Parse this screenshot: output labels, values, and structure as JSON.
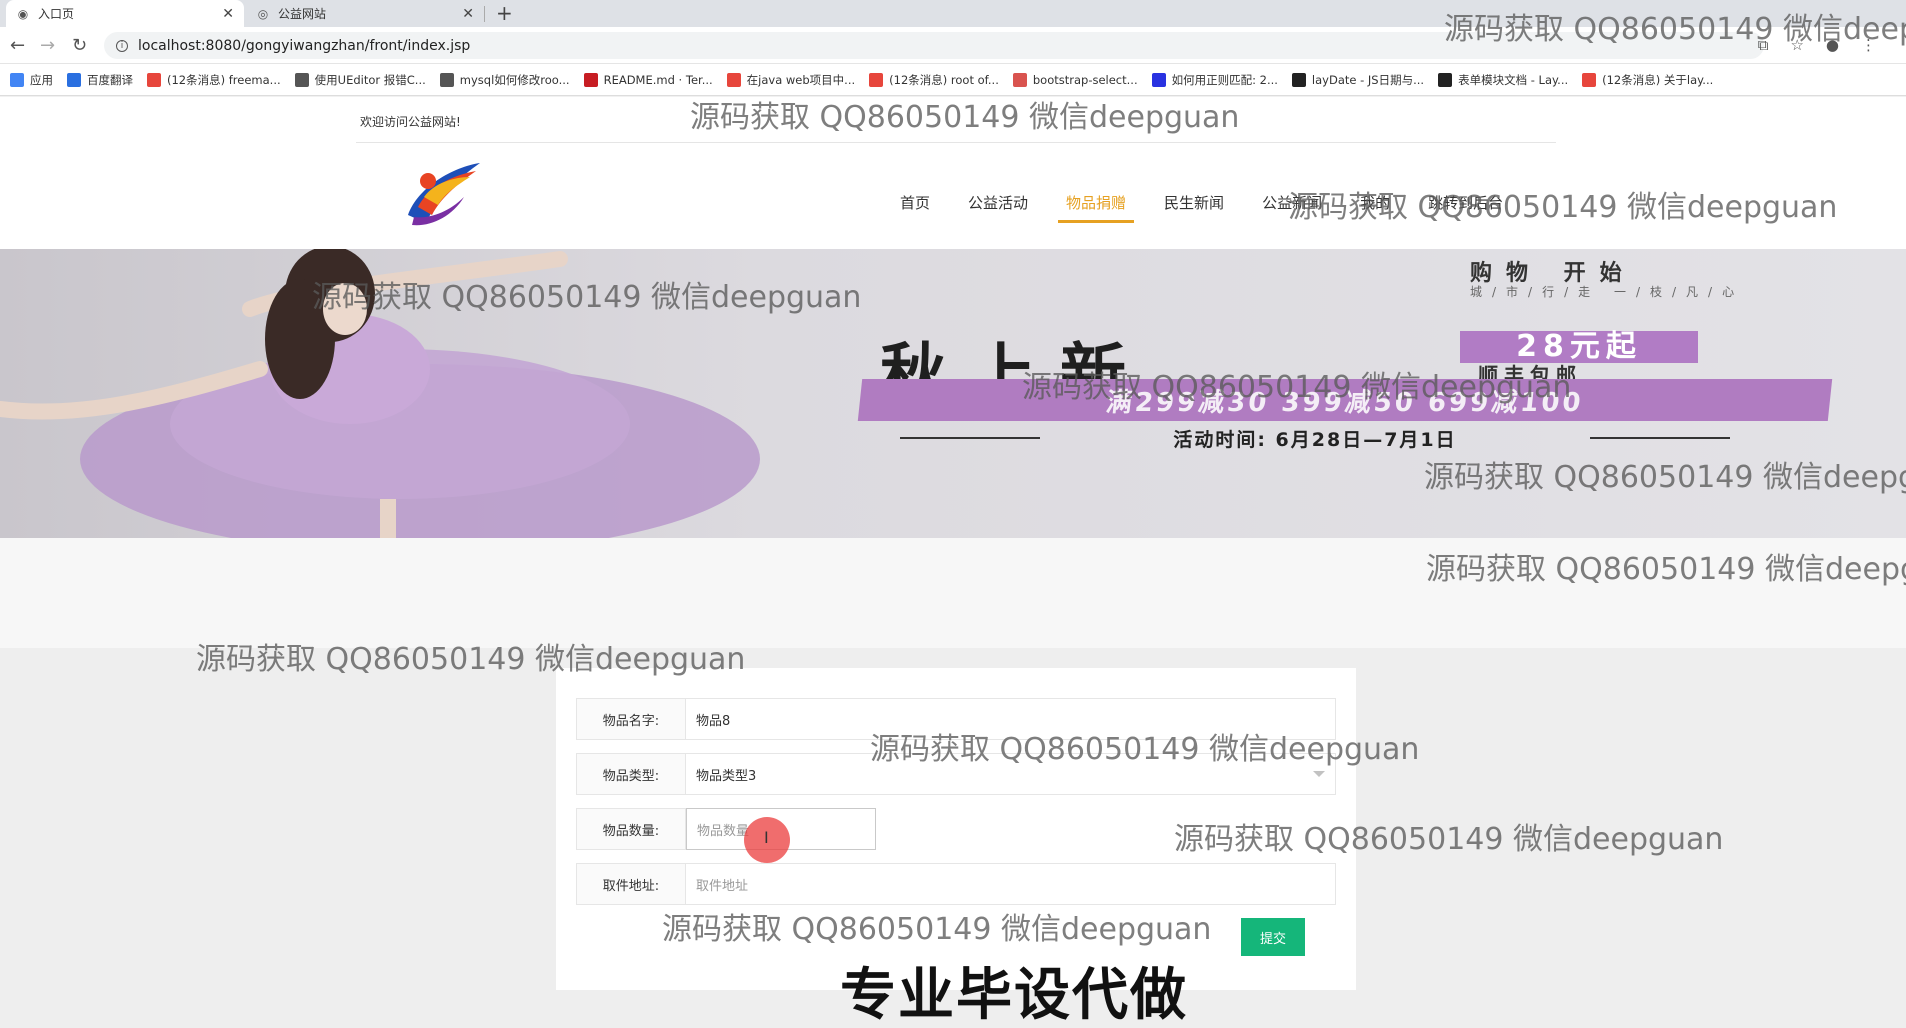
{
  "browser": {
    "tabs": [
      {
        "title": "入口页",
        "active": true
      },
      {
        "title": "公益网站",
        "active": false
      }
    ],
    "url": "localhost:8080/gongyiwangzhan/front/index.jsp",
    "bookmarks": [
      {
        "label": "应用",
        "icon": "apps-icon",
        "color": "#4285f4"
      },
      {
        "label": "百度翻译",
        "icon": "translate-icon",
        "color": "#2a6fe0"
      },
      {
        "label": "(12条消息) freema...",
        "icon": "csdn-icon",
        "color": "#e7463c"
      },
      {
        "label": "使用UEditor 报错C...",
        "icon": "link-icon",
        "color": "#555555"
      },
      {
        "label": "mysql如何修改roo...",
        "icon": "link-icon",
        "color": "#555555"
      },
      {
        "label": "README.md · Ter...",
        "icon": "gitee-icon",
        "color": "#c71d23"
      },
      {
        "label": "在java web项目中...",
        "icon": "csdn-icon",
        "color": "#e7463c"
      },
      {
        "label": "(12条消息) root of...",
        "icon": "csdn-icon",
        "color": "#e7463c"
      },
      {
        "label": "bootstrap-select...",
        "icon": "doc-icon",
        "color": "#d9534f"
      },
      {
        "label": "如何用正则匹配: 2...",
        "icon": "baidu-icon",
        "color": "#2932e1"
      },
      {
        "label": "layDate - JS日期与...",
        "icon": "layui-icon",
        "color": "#222222"
      },
      {
        "label": "表单模块文档 - Lay...",
        "icon": "layui-icon",
        "color": "#222222"
      },
      {
        "label": "(12条消息) 关于lay...",
        "icon": "csdn-icon",
        "color": "#e7463c"
      }
    ]
  },
  "header": {
    "welcome": "欢迎访问公益网站!",
    "nav": [
      {
        "label": "首页",
        "active": false
      },
      {
        "label": "公益活动",
        "active": false
      },
      {
        "label": "物品捐赠",
        "active": true
      },
      {
        "label": "民生新闻",
        "active": false
      },
      {
        "label": "公益新闻",
        "active": false
      },
      {
        "label": "我的",
        "active": false
      },
      {
        "label": "跳转到后台",
        "active": false
      }
    ],
    "accent_color": "#e6a122"
  },
  "banner": {
    "title": "秋上新",
    "top_text": "购物 开始",
    "top_sub": "城/市/行/走 一/枝/凡/心",
    "price": "28元起",
    "shipping": "顺丰包邮",
    "promo": "满299减30  399减50  699减100",
    "time": "活动时间: 6月28日—7月1日"
  },
  "form": {
    "name_label": "物品名字:",
    "name_value": "物品8",
    "type_label": "物品类型:",
    "type_value": "物品类型3",
    "qty_label": "物品数量:",
    "qty_placeholder": "物品数量",
    "addr_label": "取件地址:",
    "addr_placeholder": "取件地址",
    "submit_label": "提交",
    "submit_color": "#15b67a"
  },
  "overlay": {
    "watermark": "源码获取 QQ86050149 微信deepguan",
    "watermark_cut_1": "源码获取 QQ86050149 微信deep",
    "watermark_cut_2": "源码获取 QQ86050149 微信deepg",
    "caption": "专业毕设代做"
  }
}
